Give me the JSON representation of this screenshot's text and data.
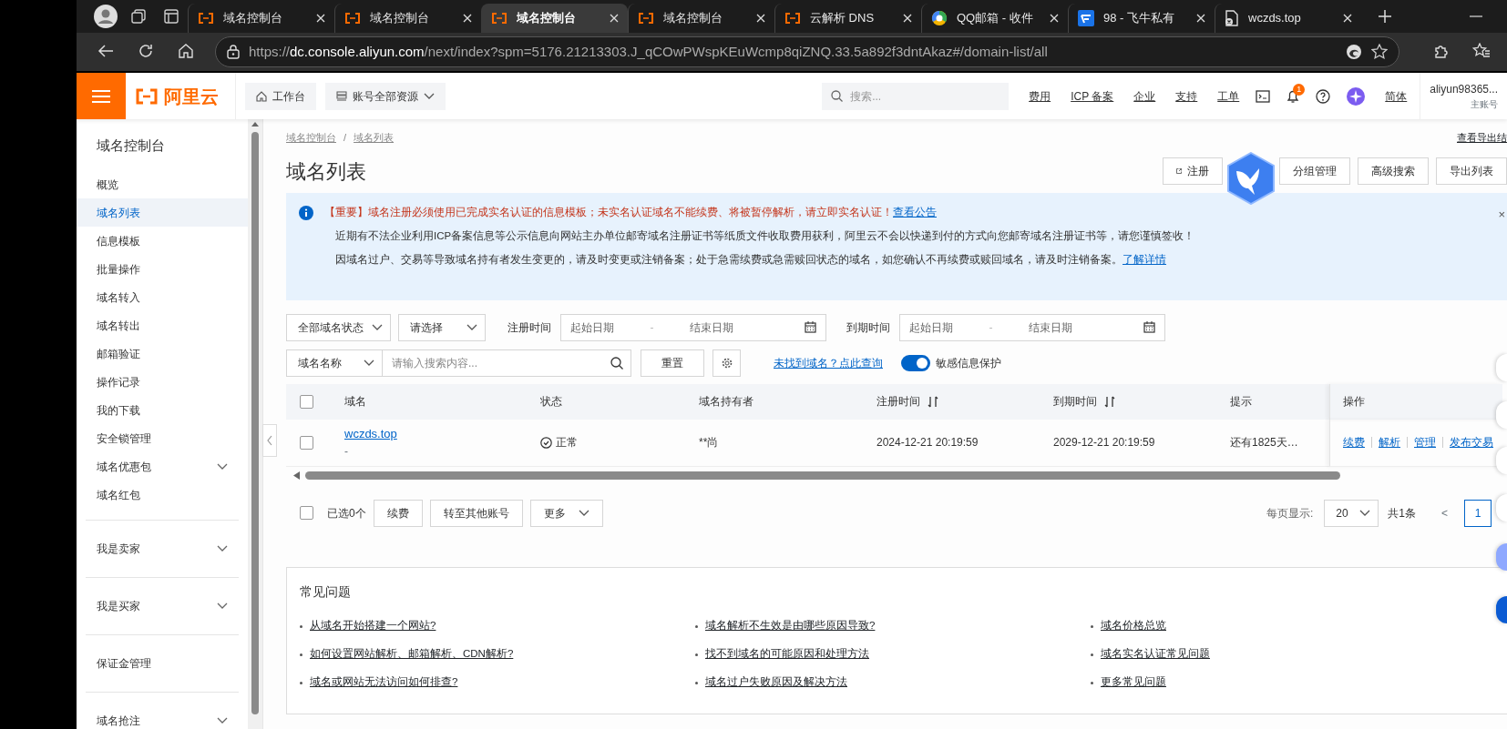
{
  "browser": {
    "tabs": [
      {
        "title": "域名控制台",
        "kind": "aliyun",
        "selected": false
      },
      {
        "title": "域名控制台",
        "kind": "aliyun",
        "selected": false
      },
      {
        "title": "域名控制台",
        "kind": "aliyun",
        "selected": true
      },
      {
        "title": "域名控制台",
        "kind": "aliyun",
        "selected": false
      },
      {
        "title": "云解析 DNS",
        "kind": "aliyun",
        "selected": false
      },
      {
        "title": "QQ邮箱 - 收件",
        "kind": "round",
        "selected": false
      },
      {
        "title": "98 - 飞牛私有",
        "kind": "square",
        "selected": false
      },
      {
        "title": "wczds.top",
        "kind": "document",
        "selected": false
      }
    ],
    "url": {
      "scheme": "https://",
      "host": "dc.console.aliyun.com",
      "path": "/next/index?spm=5176.21213303.J_qCOwPWspKEuWcmp8qiZNQ.33.5a892f3dntAkaz#/domain-list/all"
    }
  },
  "header": {
    "logo": "阿里云",
    "nav": [
      "工作台",
      "账号全部资源"
    ],
    "search": {
      "placeholder": "搜索..."
    },
    "links": [
      "费用",
      "ICP 备案",
      "企业",
      "支持",
      "工单"
    ],
    "notification_count": "1",
    "language": "简体",
    "user": {
      "name": "aliyun98365...",
      "role": "主账号"
    }
  },
  "sidebar": {
    "title": "域名控制台",
    "groups": [
      {
        "items": [
          {
            "label": "概览",
            "selected": false,
            "expandable": false
          },
          {
            "label": "域名列表",
            "selected": true,
            "expandable": false
          },
          {
            "label": "信息模板",
            "selected": false,
            "expandable": false
          },
          {
            "label": "批量操作",
            "selected": false,
            "expandable": false
          },
          {
            "label": "域名转入",
            "selected": false,
            "expandable": false
          },
          {
            "label": "域名转出",
            "selected": false,
            "expandable": false
          },
          {
            "label": "邮箱验证",
            "selected": false,
            "expandable": false
          },
          {
            "label": "操作记录",
            "selected": false,
            "expandable": false
          },
          {
            "label": "我的下载",
            "selected": false,
            "expandable": false
          },
          {
            "label": "安全锁管理",
            "selected": false,
            "expandable": false
          },
          {
            "label": "域名优惠包",
            "selected": false,
            "expandable": true
          },
          {
            "label": "域名红包",
            "selected": false,
            "expandable": false
          }
        ]
      },
      {
        "items": [
          {
            "label": "我是卖家",
            "selected": false,
            "expandable": true
          }
        ]
      },
      {
        "items": [
          {
            "label": "我是买家",
            "selected": false,
            "expandable": true
          }
        ]
      },
      {
        "items": [
          {
            "label": "保证金管理",
            "selected": false,
            "expandable": false
          }
        ]
      },
      {
        "items": [
          {
            "label": "域名抢注",
            "selected": false,
            "expandable": true
          }
        ]
      }
    ]
  },
  "content": {
    "breadcrumb": [
      "域名控制台",
      "域名列表"
    ],
    "breadcrumb_separator": "/",
    "export_results_link": "查看导出结",
    "title": "域名列表",
    "buttons": [
      "注册",
      "分组管理",
      "高级搜索",
      "导出列表"
    ],
    "alert": {
      "important": "【重要】域名注册必须使用已完成实名认证的信息模板；未实名认证域名不能续费、将被暂停解析，请立即实名认证！",
      "important_link": "查看公告",
      "line_2": "近期有不法企业利用ICP备案信息等公示信息向网站主办单位邮寄域名注册证书等纸质文件收取费用获利，阿里云不会以快递到付的方式向您邮寄域名注册证书等，请您谨慎签收！",
      "line_3": "因域名过户、交易等导致域名持有者发生变更的，请及时变更或注销备案；处于急需续费或急需赎回状态的域名，如您确认不再续费或赎回域名，请及时注销备案。",
      "line_3_link": "了解详情",
      "close": "×"
    },
    "filters": {
      "status_select": "全部域名状态",
      "type_select": "请选择",
      "registration_label": "注册时间",
      "expiry_label": "到期时间",
      "date_ranges": [
        {
          "start_placeholder": "起始日期",
          "separator": "-",
          "end_placeholder": "结束日期"
        },
        {
          "start_placeholder": "起始日期",
          "separator": "-",
          "end_placeholder": "结束日期"
        }
      ],
      "field_select": "域名名称",
      "search": {
        "placeholder": "请输入搜索内容..."
      },
      "reset_button": "重置",
      "not_found_link": "未找到域名？点此查询",
      "privacy_toggle": {
        "label": "敏感信息保护",
        "on": true
      }
    },
    "table": {
      "select_all_checked": false,
      "columns": [
        {
          "label": "域名",
          "sortable": false
        },
        {
          "label": "状态",
          "sortable": false
        },
        {
          "label": "域名持有者",
          "sortable": false
        },
        {
          "label": "注册时间",
          "sortable": true
        },
        {
          "label": "到期时间",
          "sortable": true
        },
        {
          "label": "提示",
          "sortable": false
        },
        {
          "label": "操作",
          "sortable": false
        }
      ],
      "rows": [
        {
          "checked": false,
          "domain": "wczds.top",
          "domain_note": "-",
          "status": "正常",
          "holder": "**尚",
          "registered": "2024-12-21 20:19:59",
          "expires": "2029-12-21 20:19:59",
          "hint": "还有1825天…",
          "actions": [
            "续费",
            "解析",
            "管理",
            "发布交易"
          ]
        }
      ]
    },
    "bulk": {
      "checked": false,
      "selected_count": "已选0个",
      "buttons": [
        "续费",
        "转至其他账号"
      ],
      "more": "更多"
    },
    "pagination": {
      "page_size_label": "每页显示:",
      "page_size": "20",
      "total": "共1条",
      "prev": "<",
      "pages": [
        {
          "label": "1",
          "selected": true
        }
      ]
    },
    "faq": {
      "title": "常见问题",
      "columns": [
        [
          "从域名开始搭建一个网站?",
          "如何设置网站解析、邮箱解析、CDN解析?",
          "域名或网站无法访问如何排查?"
        ],
        [
          "域名解析不生效是由哪些原因导致?",
          "找不到域名的可能原因和处理方法",
          "域名过户失败原因及解决方法"
        ],
        [
          "域名价格总览",
          "域名实名认证常见问题",
          "更多常见问题"
        ]
      ]
    }
  }
}
